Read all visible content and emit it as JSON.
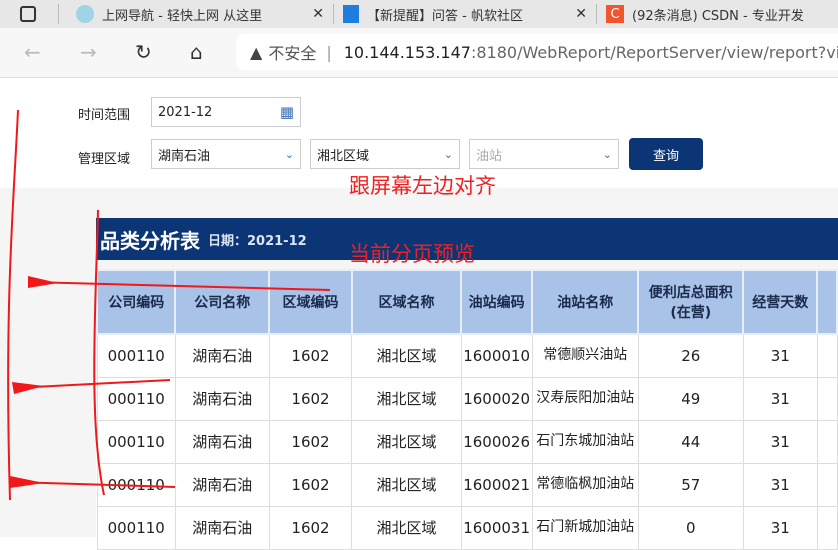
{
  "tabs": [
    {
      "label": "上网导航 - 轻快上网 从这里"
    },
    {
      "label": "【新提醒】问答 - 帆软社区"
    },
    {
      "label": "(92条消息) CSDN - 专业开发"
    }
  ],
  "address": {
    "security": "不安全",
    "host": "10.144.153.147",
    "path": ":8180/WebReport/ReportServer/view/report?vi"
  },
  "form": {
    "time_label": "时间范围",
    "time_value": "2021-12",
    "region_label": "管理区域",
    "company": "湖南石油",
    "area": "湘北区域",
    "station_placeholder": "油站",
    "query": "查询"
  },
  "report": {
    "title": "品类分析表",
    "date": "日期：2021-12",
    "headers": [
      "公司编码",
      "公司名称",
      "区域编码",
      "区域名称",
      "油站编码",
      "油站名称",
      "便利店总面积(在营)",
      "经营天数"
    ],
    "rows": [
      [
        "000110",
        "湖南石油",
        "1602",
        "湘北区域",
        "1600010",
        "常德顺兴油站",
        "26",
        "31"
      ],
      [
        "000110",
        "湖南石油",
        "1602",
        "湘北区域",
        "1600020",
        "汉寿辰阳加油站",
        "49",
        "31"
      ],
      [
        "000110",
        "湖南石油",
        "1602",
        "湘北区域",
        "1600026",
        "石门东城加油站",
        "44",
        "31"
      ],
      [
        "000110",
        "湖南石油",
        "1602",
        "湘北区域",
        "1600021",
        "常德临枫加油站",
        "57",
        "31"
      ],
      [
        "000110",
        "湖南石油",
        "1602",
        "湘北区域",
        "1600031",
        "石门新城加油站",
        "0",
        "31"
      ]
    ]
  },
  "annotations": {
    "align_note": "跟屏幕左边对齐",
    "preview_note": "当前分页预览"
  }
}
